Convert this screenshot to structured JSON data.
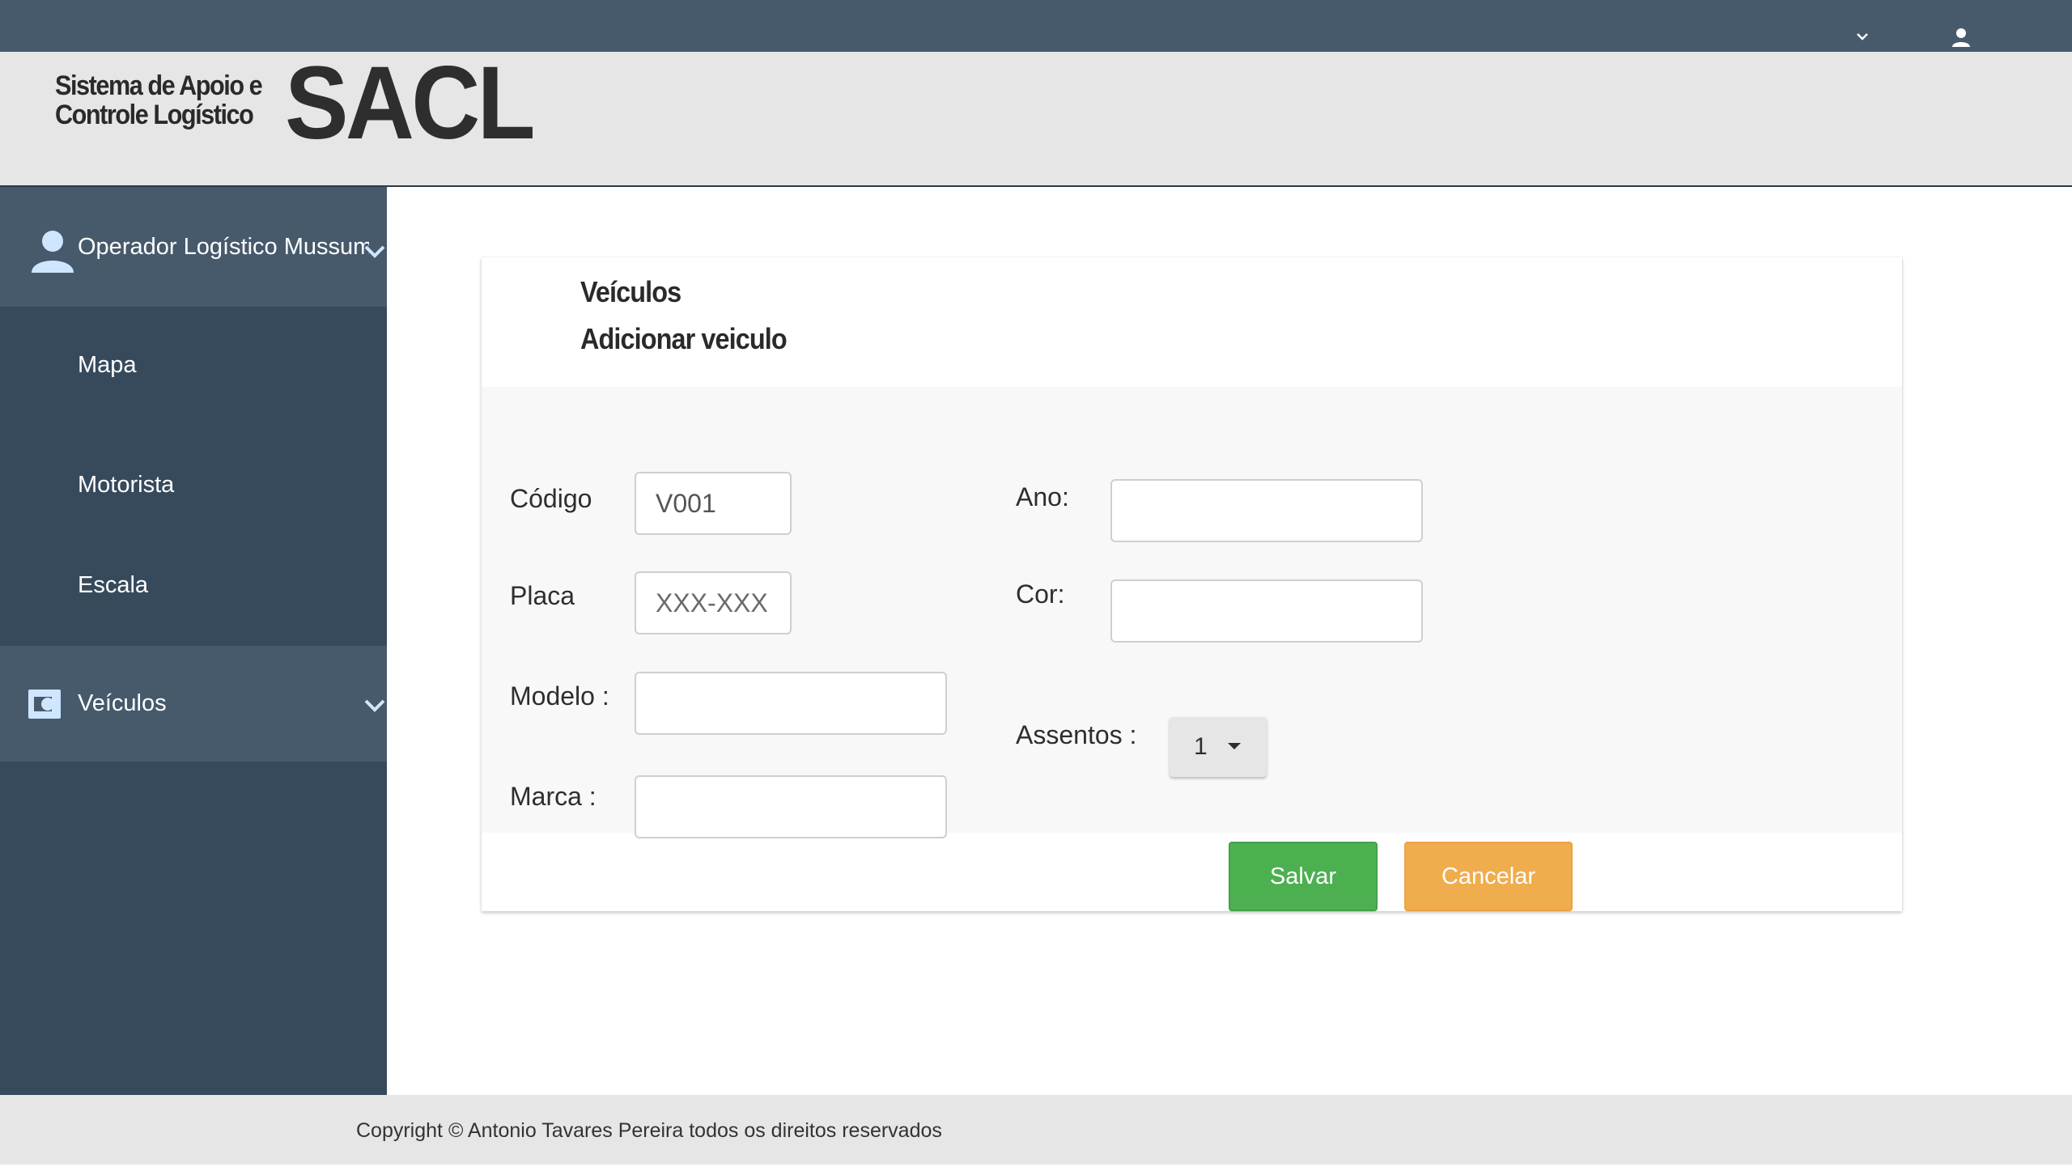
{
  "topbar": {
    "dropdown_icon": "chevron-down-icon",
    "user_icon": "user-icon"
  },
  "logo": {
    "line1": "Sistema de Apoio e",
    "line2": "Controle Logístico",
    "acronym": "SACL"
  },
  "sidebar": {
    "user": {
      "icon": "user-icon",
      "label": "Operador Logístico Mussum"
    },
    "items": [
      {
        "label": "Mapa"
      },
      {
        "label": "Motorista"
      },
      {
        "label": "Escala"
      }
    ],
    "active": {
      "icon": "vehicle-icon",
      "label": "Veículos"
    },
    "colors": {
      "background": "#374a5c",
      "highlight": "#475a6c"
    }
  },
  "card": {
    "title": "Veículos",
    "subtitle": "Adicionar veiculo"
  },
  "form": {
    "codigo": {
      "label": "Código",
      "value": "V001",
      "placeholder": ""
    },
    "placa": {
      "label": "Placa",
      "value": "",
      "placeholder": "XXX-XXX"
    },
    "modelo": {
      "label": "Modelo :",
      "value": "",
      "placeholder": ""
    },
    "marca": {
      "label": "Marca :",
      "value": "",
      "placeholder": ""
    },
    "ano": {
      "label": "Ano:",
      "value": "",
      "placeholder": ""
    },
    "cor": {
      "label": "Cor:",
      "value": "",
      "placeholder": ""
    },
    "assentos": {
      "label": "Assentos :",
      "selected": "1"
    }
  },
  "actions": {
    "save_label": "Salvar",
    "cancel_label": "Cancelar",
    "save_color": "#4cb050",
    "cancel_color": "#f0ad4e"
  },
  "footer": {
    "copyright": "Copyright © Antonio Tavares Pereira todos os direitos reservados"
  }
}
